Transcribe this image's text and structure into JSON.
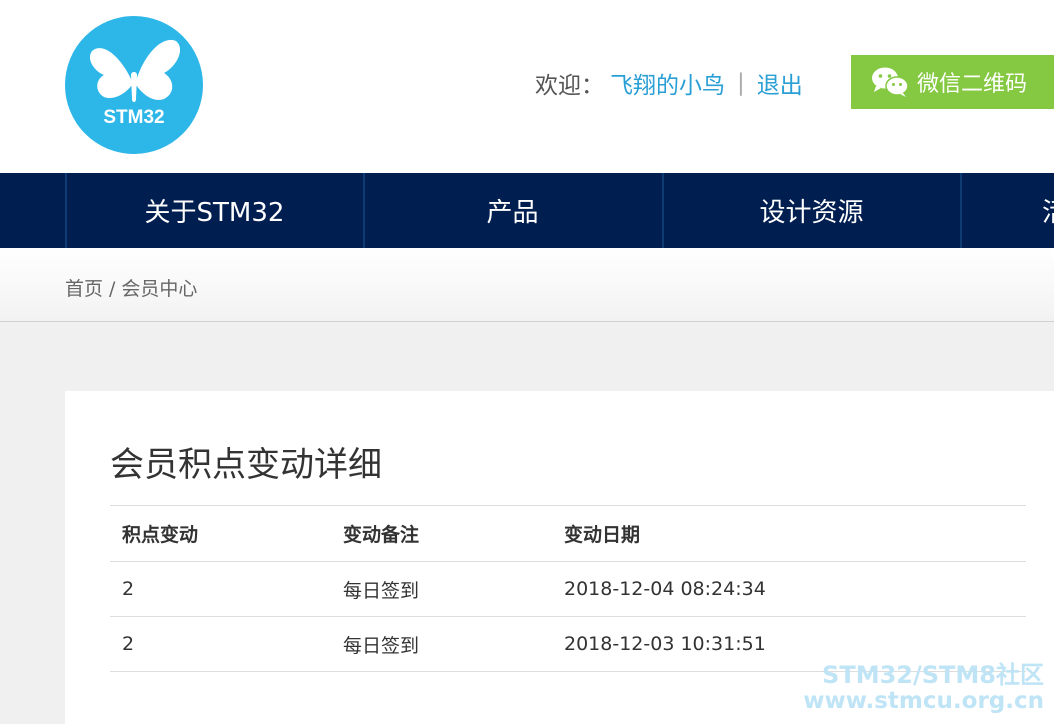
{
  "header": {
    "logo_text": "STM32",
    "welcome_label": "欢迎：",
    "username": "飞翔的小鸟",
    "separator": "|",
    "logout": "退出",
    "wechat_button": "微信二维码"
  },
  "nav": {
    "items": [
      "关于STM32",
      "产品",
      "设计资源",
      "活"
    ]
  },
  "breadcrumb": {
    "home": "首页",
    "separator": "/",
    "current": "会员中心"
  },
  "main": {
    "title": "会员积点变动详细",
    "table": {
      "headers": [
        "积点变动",
        "变动备注",
        "变动日期"
      ],
      "rows": [
        [
          "2",
          "每日签到",
          "2018-12-04 08:24:34"
        ],
        [
          "2",
          "每日签到",
          "2018-12-03 10:31:51"
        ]
      ]
    }
  },
  "watermark": {
    "line1": "STM32/STM8社区",
    "line2": "www.stmcu.org.cn"
  },
  "colors": {
    "nav_background": "#001e50",
    "link": "#2a9fd6",
    "wechat_button": "#84c941",
    "logo_circle": "#2db6e8"
  },
  "icons": {
    "logo": "butterfly-logo",
    "wechat": "wechat-icon"
  }
}
